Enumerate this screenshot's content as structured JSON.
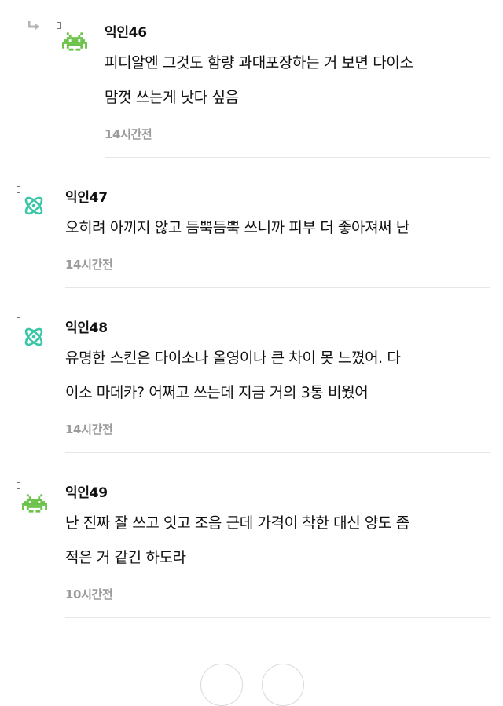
{
  "comments": [
    {
      "author": "익인46",
      "lines": [
        "피디알엔 그것도 함량 과대포장하는 거 보면 다이소",
        "맘껏 쓰는게 낫다 싶음"
      ],
      "time": "14시간전",
      "avatar_icon": "space-invader-icon",
      "is_reply": true
    },
    {
      "author": "익인47",
      "lines": [
        "오히려 아끼지 않고 듬뿍듬뿍 쓰니까 피부 더 좋아져써 난"
      ],
      "time": "14시간전",
      "avatar_icon": "atom-icon",
      "is_reply": false
    },
    {
      "author": "익인48",
      "lines": [
        "유명한 스킨은 다이소나 올영이나 큰 차이 못 느꼈어. 다",
        "이소 마데카? 어쩌고 쓰는데 지금 거의 3통 비웠어"
      ],
      "time": "14시간전",
      "avatar_icon": "atom-icon",
      "is_reply": false
    },
    {
      "author": "익인49",
      "lines": [
        "난 진짜 잘 쓰고 잇고 조음 근데 가격이 착한 대신 양도 좀",
        "적은 거 같긴 하도라"
      ],
      "time": "10시간전",
      "avatar_icon": "space-invader-icon",
      "is_reply": false
    }
  ],
  "colors": {
    "invader": "#6cc24a",
    "atom": "#3cc6a8",
    "time": "#9b9b9b",
    "divider": "#e6e6e6"
  }
}
